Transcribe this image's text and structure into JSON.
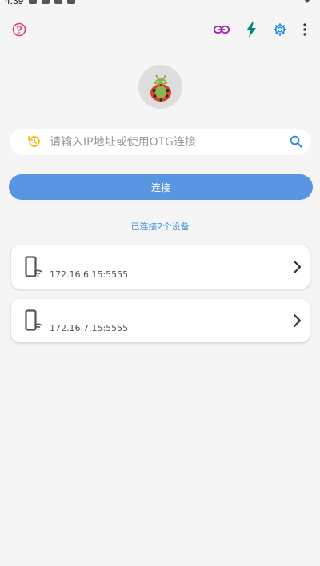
{
  "status_bar": {
    "time": "4:39"
  },
  "toolbar": {
    "help_icon": "help-circle-icon",
    "link_icon": "link-icon",
    "flash_icon": "lightning-icon",
    "settings_icon": "gear-icon",
    "more_icon": "more-vertical-icon",
    "colors": {
      "help": "#e5396c",
      "link": "#9c27b0",
      "flash": "#00897b",
      "settings": "#1e88e5"
    }
  },
  "search": {
    "placeholder": "请输入IP地址或使用OTG连接",
    "value": "",
    "history_icon": "history-icon",
    "search_icon": "search-icon"
  },
  "connect": {
    "label": "连接",
    "color": "#5a95e4"
  },
  "connected_text": "已连接2个设备",
  "devices": [
    {
      "address": "172.16.6.15:5555"
    },
    {
      "address": "172.16.7.15:5555"
    }
  ]
}
